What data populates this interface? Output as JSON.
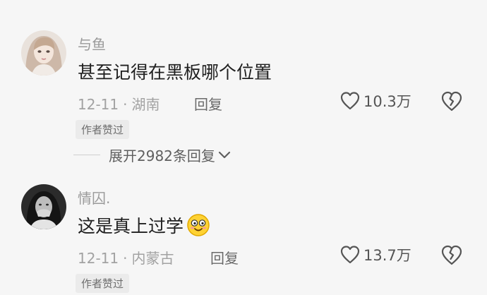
{
  "comments": [
    {
      "username": "与鱼",
      "text": "甚至记得在黑板哪个位置",
      "date": "12-11",
      "separator": "·",
      "location": "湖南",
      "reply_label": "回复",
      "likes": "10.3万",
      "badge": "作者赞过",
      "expand_label": "展开2982条回复"
    },
    {
      "username": "情囚.",
      "text": "这是真上过学",
      "emoji": "smiling-face-emoji",
      "date": "12-11",
      "separator": "·",
      "location": "内蒙古",
      "reply_label": "回复",
      "likes": "13.7万",
      "badge": "作者赞过"
    }
  ],
  "icons": {
    "like": "heart-outline-icon",
    "dislike": "broken-heart-icon",
    "expand": "chevron-down-icon"
  }
}
